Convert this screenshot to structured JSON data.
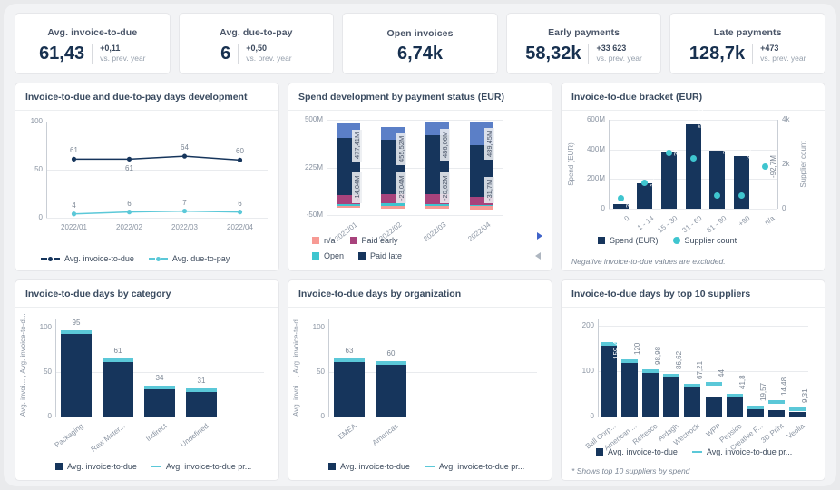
{
  "kpis": [
    {
      "title": "Avg. invoice-to-due",
      "value": "61,43",
      "delta": "+0,11",
      "delta_label": "vs. prev. year"
    },
    {
      "title": "Avg. due-to-pay",
      "value": "6",
      "delta": "+0,50",
      "delta_label": "vs. prev. year"
    },
    {
      "title": "Open invoices",
      "value": "6,74k",
      "delta": "",
      "delta_label": ""
    },
    {
      "title": "Early payments",
      "value": "58,32k",
      "delta": "+33 623",
      "delta_label": "vs. prev. year"
    },
    {
      "title": "Late payments",
      "value": "128,7k",
      "delta": "+473",
      "delta_label": "vs. prev. year"
    }
  ],
  "cards": {
    "development": {
      "title": "Invoice-to-due and due-to-pay days development"
    },
    "spend": {
      "title": "Spend development by payment status (EUR)"
    },
    "bracket": {
      "title": "Invoice-to-due bracket (EUR)",
      "footnote": "Negative invoice-to-due values are excluded."
    },
    "category": {
      "title": "Invoice-to-due days by category"
    },
    "organization": {
      "title": "Invoice-to-due days by organization"
    },
    "suppliers": {
      "title": "Invoice-to-due days by top 10 suppliers",
      "footnote": "* Shows top 10 suppliers by spend"
    }
  },
  "colors": {
    "navy": "#16355c",
    "cyan": "#5bc8d8",
    "blue_mid": "#5b7fc7",
    "magenta": "#a8437c",
    "salmon": "#f79a94",
    "teal": "#3fc5cf",
    "accent": "#3f63c9"
  },
  "chart_data": [
    {
      "id": "development",
      "type": "line",
      "title": "Invoice-to-due and due-to-pay days development",
      "categories": [
        "2022/01",
        "2022/02",
        "2022/03",
        "2022/04"
      ],
      "ylim": [
        0,
        100
      ],
      "yticks": [
        "0",
        "50",
        "100"
      ],
      "grid": true,
      "legend_position": "bottom",
      "series": [
        {
          "name": "Avg. invoice-to-due",
          "color": "#16355c",
          "values": [
            61,
            61,
            64,
            60
          ],
          "labels": [
            "61",
            "61",
            "64",
            "60"
          ]
        },
        {
          "name": "Avg. due-to-pay",
          "color": "#5bc8d8",
          "values": [
            4,
            6,
            7,
            6
          ],
          "labels": [
            "4",
            "6",
            "7",
            "6"
          ]
        }
      ]
    },
    {
      "id": "spend",
      "type": "bar",
      "stacked": true,
      "title": "Spend development by payment status (EUR)",
      "categories": [
        "2022/01",
        "2022/02",
        "2022/03",
        "2022/04"
      ],
      "ylim": [
        -50,
        500
      ],
      "yticks": [
        "-50M",
        "225M",
        "500M"
      ],
      "grid": true,
      "legend_position": "bottom",
      "legend_entries": [
        "n/a",
        "Paid early",
        "Open",
        "Paid late"
      ],
      "series": [
        {
          "name": "n/a",
          "color": "#f79a94",
          "values": [
            14.04,
            23.04,
            20.62,
            31.7
          ],
          "labels": [
            "-14,04M",
            "-23,04M",
            "-20,62M",
            "-31,7M"
          ]
        },
        {
          "name": "Open",
          "color": "#3fc5cf",
          "values": [
            12,
            18,
            14,
            6
          ],
          "labels": [
            "",
            "",
            "",
            ""
          ]
        },
        {
          "name": "Paid early",
          "color": "#a8437c",
          "values": [
            52,
            50,
            54,
            48
          ],
          "labels": [
            "",
            "",
            "",
            ""
          ]
        },
        {
          "name": "Paid late",
          "color": "#16355c",
          "values": [
            330,
            318,
            345,
            300
          ],
          "labels": [
            "",
            "",
            "",
            ""
          ]
        },
        {
          "name": "total",
          "color": "#5b7fc7",
          "values": [
            477.41,
            455.52,
            486.06,
            489.45
          ],
          "labels": [
            "477,41M",
            "455,52M",
            "486,06M",
            "489,45M"
          ]
        }
      ]
    },
    {
      "id": "bracket",
      "type": "bar",
      "title": "Invoice-to-due bracket (EUR)",
      "categories": [
        "0",
        "1 - 14",
        "15 - 30",
        "31 - 60",
        "61 - 90",
        "+90",
        "n/a"
      ],
      "ylabel": "Spend (EUR)",
      "y2label": "Supplier count",
      "ylim": [
        0,
        600
      ],
      "yticks": [
        "0",
        "200M",
        "400M",
        "600M"
      ],
      "y2ticks": [
        "0",
        "2k",
        "4k"
      ],
      "y2lim": [
        0,
        4000
      ],
      "grid": true,
      "legend_position": "bottom",
      "series": [
        {
          "name": "Spend (EUR)",
          "color": "#16355c",
          "values": [
            32.27,
            174.29,
            377.03,
            568.62,
            392.59,
            352.34,
            -92.7
          ],
          "labels": [
            "32,27M",
            "174,29M",
            "377,03M",
            "568,62M",
            "392,59M",
            "352,34M",
            "-92,7M"
          ]
        },
        {
          "name": "Supplier count",
          "color": "#3fc5cf",
          "values": [
            470,
            1180,
            2500,
            2260,
            580,
            590,
            1880
          ],
          "labels": []
        }
      ]
    },
    {
      "id": "category",
      "type": "bar",
      "title": "Invoice-to-due days by category",
      "categories": [
        "Packaging",
        "Raw Mater...",
        "Indirect",
        "Undefined"
      ],
      "ylabel": "Avg. invoi... , Avg. invoice-to-d...",
      "ylim": [
        0,
        100
      ],
      "yticks": [
        "0",
        "50",
        "100"
      ],
      "grid": true,
      "legend_position": "bottom",
      "series": [
        {
          "name": "Avg. invoice-to-due",
          "color": "#16355c",
          "values": [
            95,
            61,
            34,
            31
          ],
          "labels": [
            "95",
            "61",
            "34",
            "31"
          ]
        },
        {
          "name": "Avg. invoice-to-due pr...",
          "color": "#5bc8d8",
          "values": [
            97,
            65,
            35,
            32
          ],
          "labels": []
        }
      ]
    },
    {
      "id": "organization",
      "type": "bar",
      "title": "Invoice-to-due days by organization",
      "categories": [
        "EMEA",
        "Americas"
      ],
      "ylabel": "Avg. invoi... , Avg. invoice-to-d...",
      "ylim": [
        0,
        100
      ],
      "yticks": [
        "0",
        "50",
        "100"
      ],
      "grid": true,
      "legend_position": "bottom",
      "series": [
        {
          "name": "Avg. invoice-to-due",
          "color": "#16355c",
          "values": [
            63,
            60
          ],
          "labels": [
            "63",
            "60"
          ]
        },
        {
          "name": "Avg. invoice-to-due pr...",
          "color": "#5bc8d8",
          "values": [
            65,
            62
          ],
          "labels": []
        }
      ]
    },
    {
      "id": "suppliers",
      "type": "bar",
      "title": "Invoice-to-due days by top 10 suppliers",
      "categories": [
        "Ball Corp...",
        "American ...",
        "Refresco",
        "Ardagh",
        "Westrock",
        "WPP",
        "Pepsico",
        "Creative F...",
        "3D Print",
        "Veolia"
      ],
      "ylim": [
        0,
        200
      ],
      "yticks": [
        "0",
        "100",
        "200"
      ],
      "grid": true,
      "legend_position": "bottom",
      "series": [
        {
          "name": "Avg. invoice-to-due",
          "color": "#16355c",
          "values": [
            159.4,
            120,
            98.98,
            86.62,
            67.21,
            44,
            41.8,
            19.57,
            14.48,
            9.31
          ],
          "labels": [
            "159,4",
            "120",
            "98,98",
            "86,62",
            "67,21",
            "44",
            "41,8",
            "19,57",
            "14,48",
            "9,31"
          ]
        },
        {
          "name": "Avg. invoice-to-due pr...",
          "color": "#5bc8d8",
          "values": [
            163,
            126,
            104,
            93,
            71,
            75,
            49,
            24,
            35,
            19
          ],
          "labels": []
        }
      ]
    }
  ]
}
